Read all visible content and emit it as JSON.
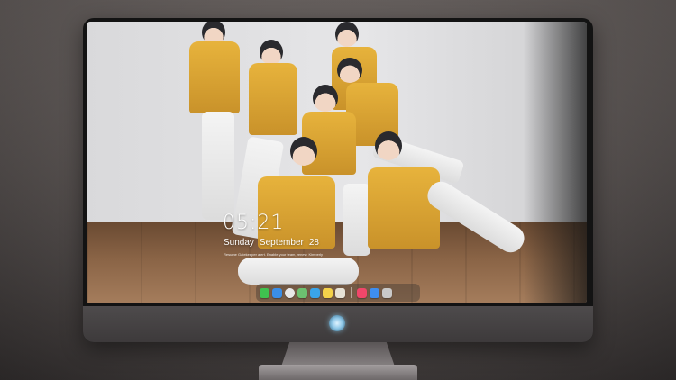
{
  "lock_screen": {
    "time": "05:21",
    "weekday": "Sunday",
    "month": "September",
    "day": "28",
    "notice": "Resume Gatekeeper alert. Enable your team, renew. Kimberly"
  },
  "wallpaper": {
    "description_icon": "group-photo-wallpaper"
  },
  "dock": {
    "apps": [
      {
        "name": "messages-icon",
        "color": "#3fc24f"
      },
      {
        "name": "mail-icon",
        "color": "#3a8ee6"
      },
      {
        "name": "safari-icon",
        "color": "#e8e8e8"
      },
      {
        "name": "maps-icon",
        "color": "#6cc070"
      },
      {
        "name": "finder-icon",
        "color": "#3aa4e8"
      },
      {
        "name": "notes-icon",
        "color": "#f4d24a"
      },
      {
        "name": "photos-icon",
        "color": "#e7e2d5"
      },
      {
        "name": "music-icon",
        "color": "#f0476a"
      },
      {
        "name": "app-store-icon",
        "color": "#3e8ef0"
      },
      {
        "name": "trash-icon",
        "color": "#c9c9c9"
      }
    ]
  },
  "monitor": {
    "logo": "crystal-logo-icon"
  }
}
